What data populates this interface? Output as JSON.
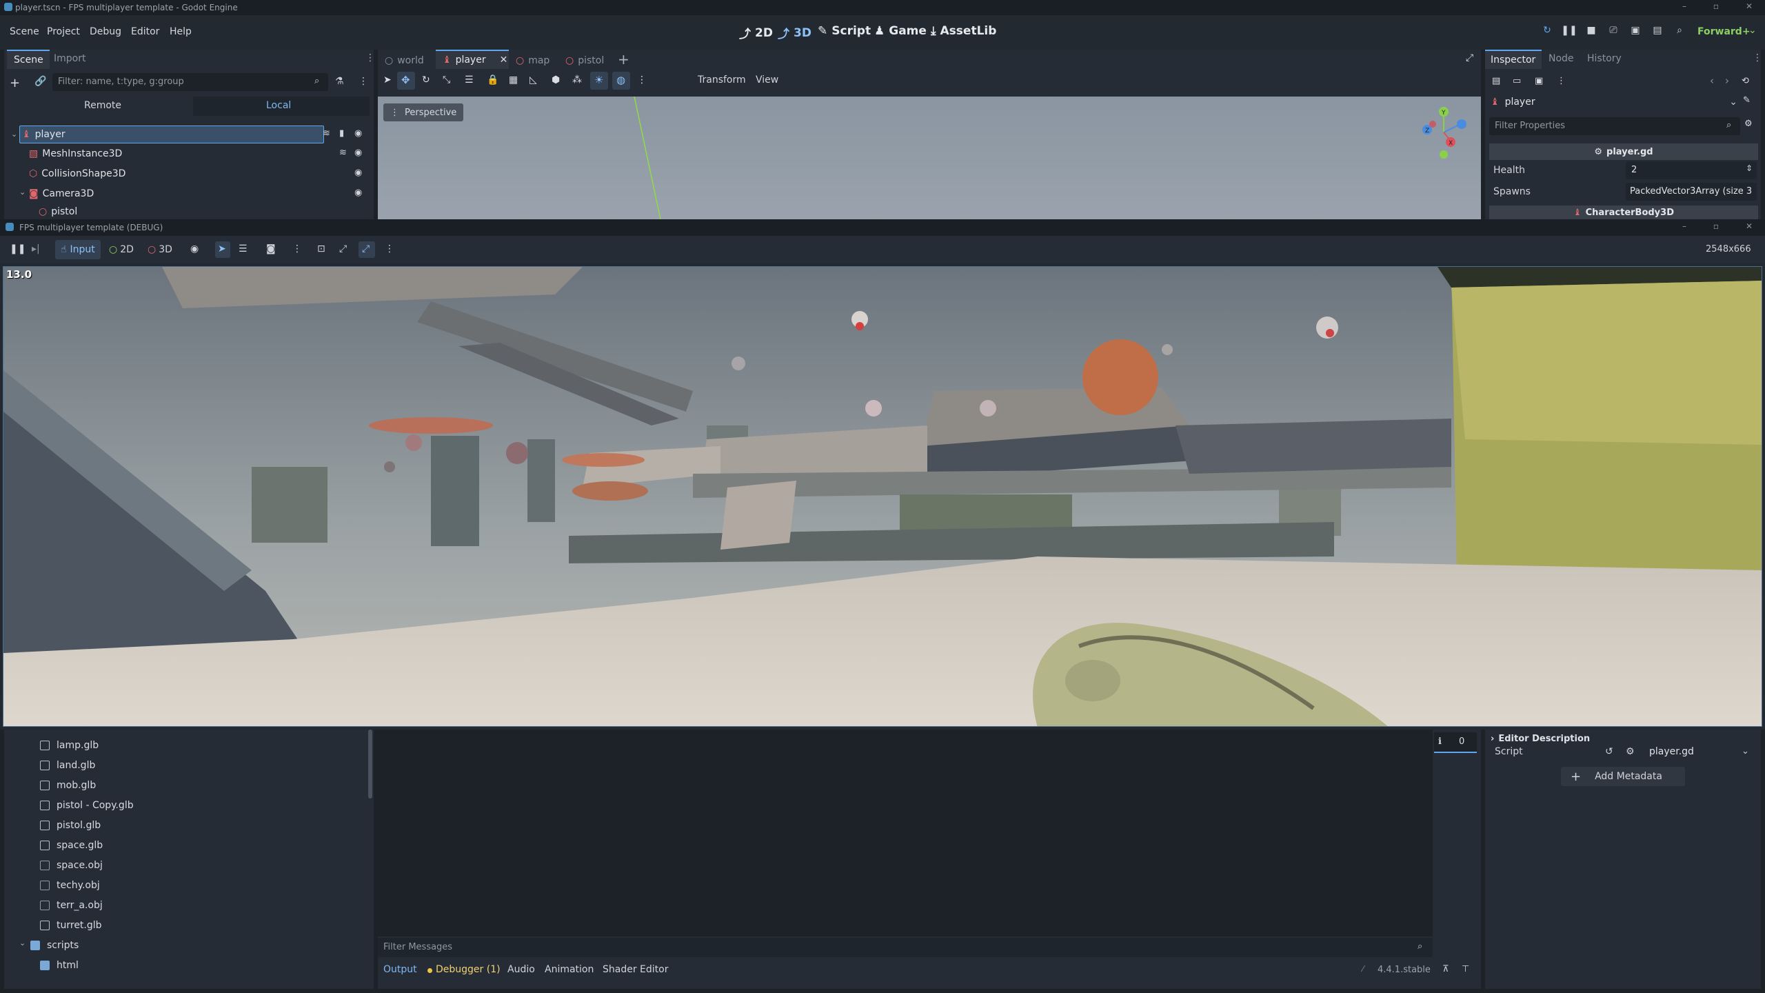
{
  "window": {
    "title": "player.tscn - FPS multiplayer template - Godot Engine"
  },
  "menubar": {
    "menus": [
      "Scene",
      "Project",
      "Debug",
      "Editor",
      "Help"
    ],
    "main_buttons": [
      "2D",
      "3D",
      "Script",
      "Game",
      "AssetLib"
    ],
    "renderer": "Forward+"
  },
  "scene_dock": {
    "tabs": [
      "Scene",
      "Import"
    ],
    "filter_placeholder": "Filter: name, t:type, g:group",
    "remote_label": "Remote",
    "local_label": "Local",
    "nodes": [
      {
        "name": "player"
      },
      {
        "name": "MeshInstance3D"
      },
      {
        "name": "CollisionShape3D"
      },
      {
        "name": "Camera3D"
      },
      {
        "name": "pistol"
      }
    ]
  },
  "viewport": {
    "tabs": [
      "world",
      "player",
      "map",
      "pistol"
    ],
    "toolbar_menus": [
      "Transform",
      "View"
    ],
    "perspective_label": "Perspective",
    "gizmo_axes": [
      "Y",
      "X",
      "Z"
    ]
  },
  "inspector": {
    "tabs": [
      "Inspector",
      "Node",
      "History"
    ],
    "object_name": "player",
    "filter_placeholder": "Filter Properties",
    "script_header": "player.gd",
    "properties": [
      {
        "name": "Health",
        "value": "2"
      },
      {
        "name": "Spawns",
        "value": "PackedVector3Array (size 3"
      }
    ],
    "class_header": "CharacterBody3D",
    "editor_description": "Editor Description",
    "script_label": "Script",
    "script_value": "player.gd",
    "add_metadata": "Add Metadata"
  },
  "game_window": {
    "title": "FPS multiplayer template (DEBUG)",
    "toolbar": [
      "Input",
      "2D",
      "3D"
    ],
    "resolution": "2548x666",
    "fps": "13.0"
  },
  "filesystem": {
    "files": [
      "lamp.glb",
      "land.glb",
      "mob.glb",
      "pistol - Copy.glb",
      "pistol.glb",
      "space.glb",
      "space.obj",
      "techy.obj",
      "terr_a.obj",
      "turret.glb"
    ],
    "folders": [
      "scripts",
      "html"
    ]
  },
  "bottom_panel": {
    "filter_placeholder": "Filter Messages",
    "tabs": [
      "Output",
      "Debugger (1)",
      "Audio",
      "Animation",
      "Shader Editor"
    ],
    "version": "4.4.1.stable",
    "message_count": "0"
  },
  "colors": {
    "accent": "#5fa8f0",
    "panel": "#262c35",
    "base": "#1d2229",
    "node_icon_red": "#e0676b"
  }
}
